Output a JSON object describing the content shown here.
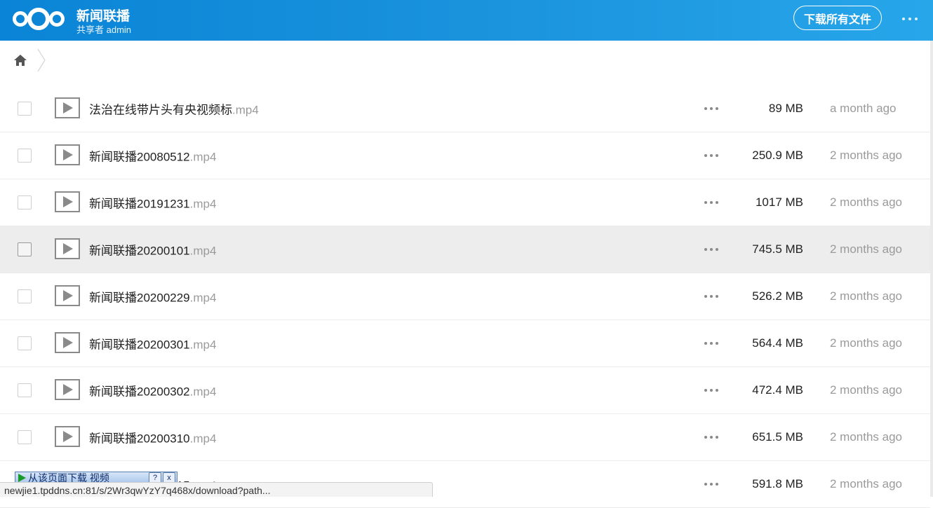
{
  "header": {
    "title": "新闻联播",
    "subtitle": "共享者 admin",
    "download_all_label": "下载所有文件",
    "accent_gradient": [
      "#0a84d6",
      "#27a6ea"
    ]
  },
  "breadcrumb": {
    "home_icon": "home-icon"
  },
  "files": [
    {
      "base": "法治在线带片头有央视频标",
      "ext": ".mp4",
      "size": "89 MB",
      "modified": "a month ago"
    },
    {
      "base": "新闻联播20080512",
      "ext": ".mp4",
      "size": "250.9 MB",
      "modified": "2 months ago"
    },
    {
      "base": "新闻联播20191231",
      "ext": ".mp4",
      "size": "1017 MB",
      "modified": "2 months ago"
    },
    {
      "base": "新闻联播20200101",
      "ext": ".mp4",
      "size": "745.5 MB",
      "modified": "2 months ago",
      "hovered": true
    },
    {
      "base": "新闻联播20200229",
      "ext": ".mp4",
      "size": "526.2 MB",
      "modified": "2 months ago"
    },
    {
      "base": "新闻联播20200301",
      "ext": ".mp4",
      "size": "564.4 MB",
      "modified": "2 months ago"
    },
    {
      "base": "新闻联播20200302",
      "ext": ".mp4",
      "size": "472.4 MB",
      "modified": "2 months ago"
    },
    {
      "base": "新闻联播20200310",
      "ext": ".mp4",
      "size": "651.5 MB",
      "modified": "2 months ago"
    },
    {
      "base": "新闻联播20200315",
      "ext": ".mp4",
      "size": "591.8 MB",
      "modified": "2 months ago"
    }
  ],
  "popup_toolbar": {
    "label": "从该页面下载 视频",
    "help_label": "?",
    "close_label": "x"
  },
  "status_bar": {
    "url": "newjie1.tpddns.cn:81/s/2Wr3qwYzY7q468x/download?path..."
  }
}
